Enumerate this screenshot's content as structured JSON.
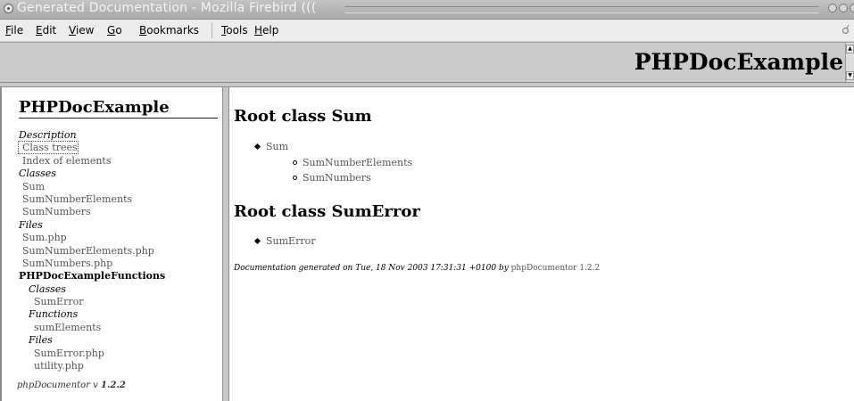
{
  "window": {
    "title": "Generated Documentation - Mozilla Firebird ((("
  },
  "menu": [
    {
      "label": "File",
      "acc": "F",
      "rest": "ile"
    },
    {
      "label": "Edit",
      "acc": "E",
      "rest": "dit"
    },
    {
      "label": "View",
      "acc": "V",
      "rest": "iew"
    },
    {
      "label": "Go",
      "acc": "G",
      "rest": "o"
    },
    {
      "label": "Bookmarks",
      "acc": "B",
      "rest": "ookmarks"
    },
    {
      "label": "Tools",
      "acc": "T",
      "rest": "ools"
    },
    {
      "label": "Help",
      "acc": "H",
      "rest": "elp"
    }
  ],
  "header": {
    "title": "PHPDocExample"
  },
  "sidebar": {
    "title": "PHPDocExample",
    "items": [
      {
        "text": "Description",
        "style": "section"
      },
      {
        "text": "Class trees",
        "style": "link-focus"
      },
      {
        "text": "Index of elements",
        "style": "link"
      },
      {
        "text": "Classes",
        "style": "section"
      },
      {
        "text": "Sum",
        "style": "link"
      },
      {
        "text": "SumNumberElements",
        "style": "link"
      },
      {
        "text": "SumNumbers",
        "style": "link"
      },
      {
        "text": "Files",
        "style": "section"
      },
      {
        "text": "Sum.php",
        "style": "link"
      },
      {
        "text": "SumNumberElements.php",
        "style": "link"
      },
      {
        "text": "SumNumbers.php",
        "style": "link"
      },
      {
        "text": "PHPDocExampleFunctions",
        "style": "package"
      },
      {
        "text": "Classes",
        "style": "subsection"
      },
      {
        "text": "SumError",
        "style": "sublink"
      },
      {
        "text": "Functions",
        "style": "subsection"
      },
      {
        "text": "sumElements",
        "style": "sublink"
      },
      {
        "text": "Files",
        "style": "subsection"
      },
      {
        "text": "SumError.php",
        "style": "sublink"
      },
      {
        "text": "utility.php",
        "style": "sublink"
      }
    ],
    "footer_prefix": "phpDocumentor v ",
    "footer_version": "1.2.2"
  },
  "main": {
    "heading1": "Root class Sum",
    "tree1": {
      "root": "Sum",
      "children": [
        "SumNumberElements",
        "SumNumbers"
      ]
    },
    "heading2": "Root class SumError",
    "tree2": {
      "root": "SumError"
    },
    "generated_prefix": "Documentation generated on Tue, 18 Nov 2003 17:31:31 +0100 by ",
    "generated_link": "phpDocumentor 1.2.2"
  }
}
